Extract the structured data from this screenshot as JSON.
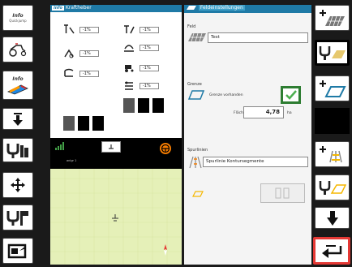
{
  "left_column": {
    "btn1": {
      "title": "Info",
      "sub": "Quickjump"
    },
    "btn3": {
      "title": "Info"
    }
  },
  "kraftheber": {
    "title": "Kraftheber",
    "values": [
      "-1%",
      "-1%",
      "-1%",
      "-1%",
      "-1%",
      "-1%",
      "-1%"
    ]
  },
  "feld": {
    "title": "Feldeinstellungen",
    "feld_label": "Feld",
    "feld_value": "Test",
    "grenze_label": "Grenze",
    "grenze_vorhanden": "Grenze vorhanden",
    "flaeche_label": "Fläche",
    "flaeche_value": "4,78",
    "flaeche_unit": "ha",
    "spurlinien_label": "Spurlinien",
    "spurlinien_value": "Spurlinie Kontursegmente"
  },
  "map": {
    "signal_label": "anlgr 1"
  },
  "colors": {
    "titlebar": "#1f7aa6",
    "map_bg": "#e5f0b8",
    "checkbox_frame": "#2e7d32",
    "highlight": "#e53935"
  }
}
